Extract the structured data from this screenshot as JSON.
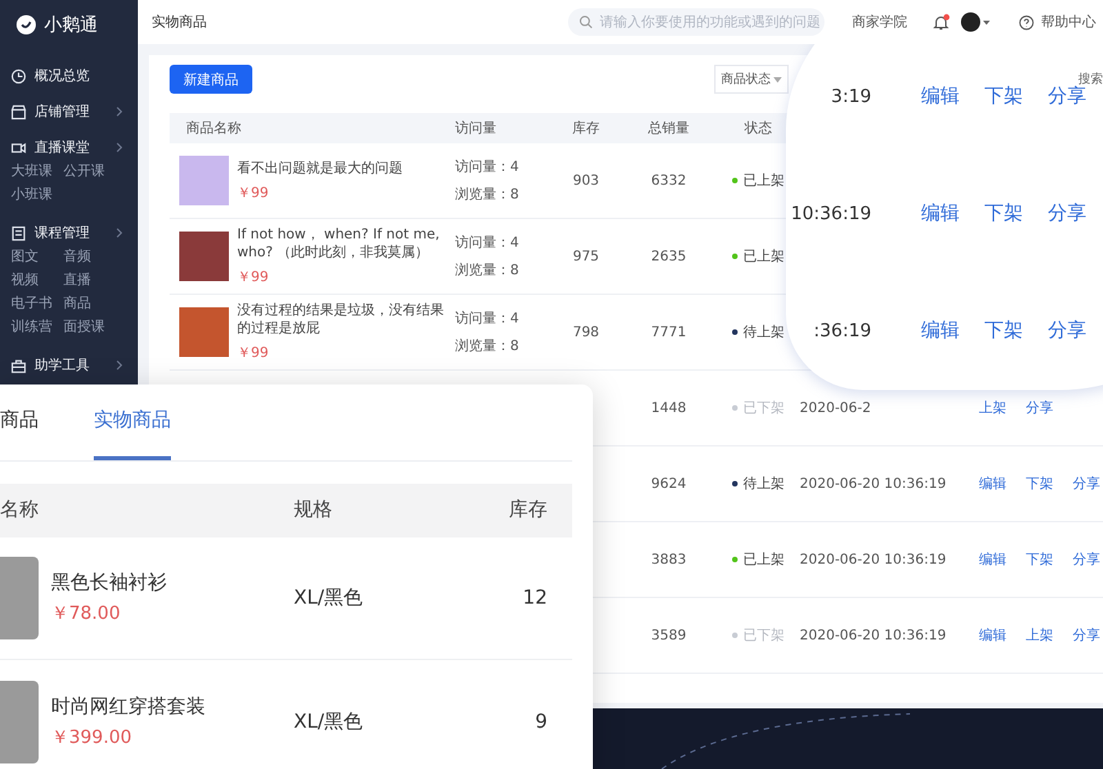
{
  "sidebar": {
    "logo": "小鹅通",
    "items": [
      {
        "label": "概况总览",
        "expandable": false
      },
      {
        "label": "店铺管理",
        "expandable": true
      },
      {
        "label": "直播课堂",
        "expandable": true,
        "children": [
          "大班课",
          "公开课",
          "小班课"
        ]
      },
      {
        "label": "课程管理",
        "expandable": true,
        "children": [
          "图文",
          "音频",
          "视频",
          "直播",
          "电子书",
          "商品",
          "训练营",
          "面授课"
        ]
      },
      {
        "label": "助学工具",
        "expandable": true
      }
    ]
  },
  "top_bar": {
    "title": "实物商品",
    "search": {
      "placeholder": "请输入你要使用的功能或遇到的问题"
    },
    "link": "商家学院",
    "help": "帮助中心"
  },
  "toolbar": {
    "new_button": "新建商品",
    "status_filter": "商品状态"
  },
  "table": {
    "columns": [
      "商品名称",
      "访问量",
      "库存",
      "总销量",
      "状态"
    ],
    "rows": [
      {
        "name": "看不出问题就是最大的问题",
        "price": "￥99",
        "visits": "访问量：4",
        "views": "浏览量：8",
        "stock": "903",
        "sales": "6332",
        "status": {
          "label": "已上架",
          "kind": "on"
        }
      },
      {
        "name": "If not how， when?  If not me, who? （此时此刻，非我莫属）",
        "price": "￥99",
        "visits": "访问量：4",
        "views": "浏览量：8",
        "stock": "975",
        "sales": "2635",
        "status": {
          "label": "已上架",
          "kind": "on"
        }
      },
      {
        "name": "没有过程的结果是垃圾，没有结果的过程是放屁",
        "price": "￥99",
        "visits": "访问量：4",
        "views": "浏览量：8",
        "stock": "798",
        "sales": "7771",
        "status": {
          "label": "待上架",
          "kind": "pending"
        }
      },
      {
        "sales": "1448",
        "status": {
          "label": "已下架",
          "kind": "off"
        },
        "time": "2020-06-2",
        "actions": [
          "上架",
          "分享"
        ]
      },
      {
        "sales": "9624",
        "status": {
          "label": "待上架",
          "kind": "pending"
        },
        "time": "2020-06-20 10:36:19",
        "actions": [
          "编辑",
          "下架",
          "分享"
        ]
      },
      {
        "sales": "3883",
        "status": {
          "label": "已上架",
          "kind": "on"
        },
        "time": "2020-06-20 10:36:19",
        "actions": [
          "编辑",
          "下架",
          "分享"
        ]
      },
      {
        "sales": "3589",
        "status": {
          "label": "已下架",
          "kind": "off"
        },
        "time": "2020-06-20 10:36:19",
        "actions": [
          "编辑",
          "上架",
          "分享"
        ]
      }
    ]
  },
  "magnifier": {
    "label": "搜索",
    "rows": [
      {
        "time": "3:19",
        "actions": [
          "编辑",
          "下架",
          "分享"
        ]
      },
      {
        "time": "10:36:19",
        "actions": [
          "编辑",
          "下架",
          "分享"
        ]
      },
      {
        "time": ":36:19",
        "actions": [
          "编辑",
          "下架",
          "分享"
        ]
      }
    ]
  },
  "overlay_card": {
    "tabs": [
      {
        "label": "商品",
        "selected": false
      },
      {
        "label": "实物商品",
        "selected": true
      }
    ],
    "columns": [
      "名称",
      "规格",
      "库存"
    ],
    "rows": [
      {
        "name": "黑色长袖衬衫",
        "price": "￥78.00",
        "spec": "XL/黑色",
        "stock": "12"
      },
      {
        "name": "时尚网红穿搭套装",
        "price": "￥399.00",
        "spec": "XL/黑色",
        "stock": "9"
      }
    ]
  }
}
